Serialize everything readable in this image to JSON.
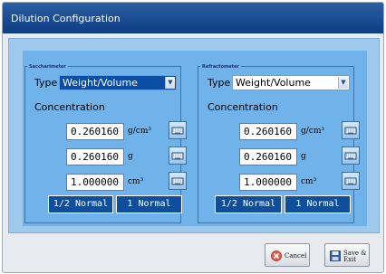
{
  "window": {
    "title": "Dilution Configuration"
  },
  "saccharimeter": {
    "group_title": "Saccharimeter",
    "type_label": "Type",
    "type_value": "Weight/Volume",
    "concentration_label": "Concentration",
    "rows": [
      {
        "value": "0.260160",
        "unit": "g/cm³"
      },
      {
        "value": "0.260160",
        "unit": "g"
      },
      {
        "value": "1.000000",
        "unit": "cm³"
      }
    ],
    "half_normal": "1/2 Normal",
    "normal": "1 Normal"
  },
  "refractometer": {
    "group_title": "Refractometer",
    "type_label": "Type",
    "type_value": "Weight/Volume",
    "concentration_label": "Concentration",
    "rows": [
      {
        "value": "0.260160",
        "unit": "g/cm³"
      },
      {
        "value": "0.260160",
        "unit": "g"
      },
      {
        "value": "1.000000",
        "unit": "cm³"
      }
    ],
    "half_normal": "1/2 Normal",
    "normal": "1 Normal"
  },
  "actions": {
    "cancel": "Cancel",
    "save_exit": "Save & Exit"
  },
  "icons": {
    "keyboard": "keyboard-icon",
    "cancel": "cancel-icon",
    "save": "floppy-disk-icon",
    "dropdown": "chevron-down-icon"
  },
  "colors": {
    "title_bar": "#0d3d82",
    "panel": "#6fb3ea",
    "selected": "#0c4ea5",
    "normal_button": "#0f4e9a"
  }
}
